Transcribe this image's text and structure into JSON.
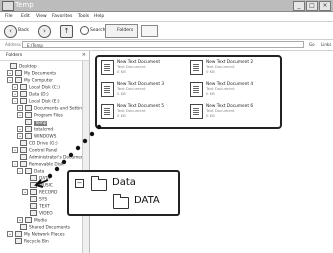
{
  "window": {
    "title": "Temp"
  },
  "menubar": [
    "File",
    "Edit",
    "View",
    "Favorites",
    "Tools",
    "Help"
  ],
  "toolbar": {
    "back_label": "Back",
    "search_label": "Search",
    "folders_label": "Folders"
  },
  "addressbar": {
    "label": "Address",
    "value": "E:\\Temp",
    "go_label": "Go",
    "links_label": "Links"
  },
  "folders_pane": {
    "title": "Folders",
    "close_glyph": "×",
    "tree": [
      {
        "label": "Desktop",
        "depth": 0,
        "exp": ""
      },
      {
        "label": "My Documents",
        "depth": 1,
        "exp": "+"
      },
      {
        "label": "My Computer",
        "depth": 1,
        "exp": "−"
      },
      {
        "label": "Local Disk (C:)",
        "depth": 2,
        "exp": "+"
      },
      {
        "label": "Data (D:)",
        "depth": 2,
        "exp": "+"
      },
      {
        "label": "Local Disk (E:)",
        "depth": 2,
        "exp": "−"
      },
      {
        "label": "Documents and Settin",
        "depth": 3,
        "exp": "+"
      },
      {
        "label": "Program Files",
        "depth": 3,
        "exp": "+"
      },
      {
        "label": "Temp",
        "depth": 3,
        "exp": "",
        "selected": true
      },
      {
        "label": "totalcmd",
        "depth": 3,
        "exp": "+"
      },
      {
        "label": "WINDOWS",
        "depth": 3,
        "exp": "+"
      },
      {
        "label": "CD Drive (G:)",
        "depth": 2,
        "exp": ""
      },
      {
        "label": "Control Panel",
        "depth": 2,
        "exp": "+"
      },
      {
        "label": "Administrator's Documents",
        "depth": 2,
        "exp": ""
      },
      {
        "label": "Removable Disk",
        "depth": 2,
        "exp": "−"
      },
      {
        "label": "Data",
        "depth": 3,
        "exp": "−"
      },
      {
        "label": "DATA",
        "depth": 4,
        "exp": ""
      },
      {
        "label": "MUSIC",
        "depth": 4,
        "exp": ""
      },
      {
        "label": "RECORD",
        "depth": 4,
        "exp": "+"
      },
      {
        "label": "SYS",
        "depth": 4,
        "exp": ""
      },
      {
        "label": "TEXT",
        "depth": 4,
        "exp": ""
      },
      {
        "label": "VIDEO",
        "depth": 4,
        "exp": ""
      },
      {
        "label": "Media",
        "depth": 3,
        "exp": "+"
      },
      {
        "label": "Shared Documents",
        "depth": 2,
        "exp": ""
      },
      {
        "label": "My Network Places",
        "depth": 1,
        "exp": "+"
      },
      {
        "label": "Recycle Bin",
        "depth": 1,
        "exp": ""
      }
    ]
  },
  "files": [
    {
      "name": "New Text Document",
      "type": "Text Document",
      "size": "0 KB"
    },
    {
      "name": "New Text Document 2",
      "type": "Text Document",
      "size": "0 KB"
    },
    {
      "name": "New Text Document 3",
      "type": "Text Document",
      "size": "0 KB"
    },
    {
      "name": "New Text Document 4",
      "type": "Text Document",
      "size": "0 KB"
    },
    {
      "name": "New Text Document 5",
      "type": "Text Document",
      "size": "0 KB"
    },
    {
      "name": "New Text Document 6",
      "type": "Text Document",
      "size": "0 KB"
    }
  ],
  "zoom": {
    "expander": "−",
    "parent_label": "Data",
    "child_label": "DATA"
  },
  "icons": [
    "folder-icon",
    "document-icon",
    "back-arrow-icon",
    "forward-arrow-icon",
    "up-folder-icon",
    "search-icon",
    "views-icon",
    "expand-icon",
    "collapse-icon"
  ]
}
